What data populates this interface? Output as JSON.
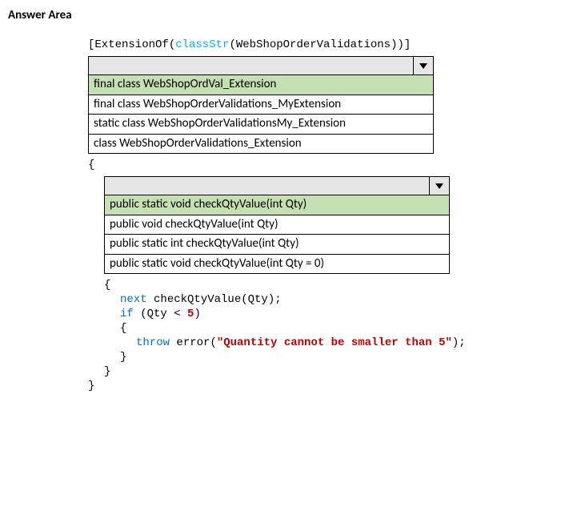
{
  "heading": "Answer Area",
  "code": {
    "attr_open": "[ExtensionOf(",
    "attr_classstr": "classStr",
    "attr_mid": "(WebShopOrderValidations))]",
    "brace_open": "{",
    "brace_close": "}",
    "inner_brace_open": "{",
    "next_kw": "next",
    "next_rest": " checkQtyValue(Qty);",
    "if_kw": "if",
    "if_cond_a": " (Qty < ",
    "if_num": "5",
    "if_cond_b": ")",
    "inner2_brace_open": "{",
    "throw_kw": "throw",
    "throw_mid": " error(",
    "throw_str": "\"Quantity cannot be smaller than 5\"",
    "throw_end": ");",
    "inner2_brace_close": "}",
    "inner_brace_close": "}"
  },
  "dropdown1": {
    "options": [
      "final class WebShopOrdVal_Extension",
      "final class WebShopOrderValidations_MyExtension",
      "static class WebShopOrderValidationsMy_Extension",
      "class WebShopOrderValidations_Extension"
    ],
    "selected_index": 0
  },
  "dropdown2": {
    "options": [
      "public static void checkQtyValue(int Qty)",
      "public void checkQtyValue(int Qty)",
      "public static int checkQtyValue(int Qty)",
      "public static void checkQtyValue(int Qty = 0)"
    ],
    "selected_index": 0
  }
}
